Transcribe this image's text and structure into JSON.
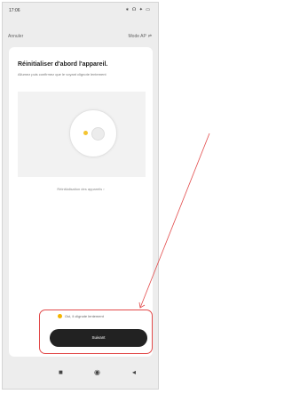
{
  "status_bar": {
    "time": "17:06",
    "icons": "∗ ☊ ✦ ▭"
  },
  "app_bar": {
    "cancel_label": "Annuler",
    "mode_label": "Mode AP"
  },
  "card": {
    "title": "Réinitialiser d'abord l'appareil.",
    "subtitle": "Allumez puis confirmez que le voyant clignote lentement",
    "reset_link": "Réinitialisation des appareils",
    "confirm_text": "Oui, il clignote lentement",
    "next_label": "Suivant"
  },
  "colors": {
    "led": "#f4c430",
    "radio": "#f4b400",
    "button_bg": "#222222",
    "annotation": "#e24a4a"
  },
  "icons": {
    "nav_back": "square",
    "nav_home": "circle",
    "nav_recent": "triangle"
  }
}
